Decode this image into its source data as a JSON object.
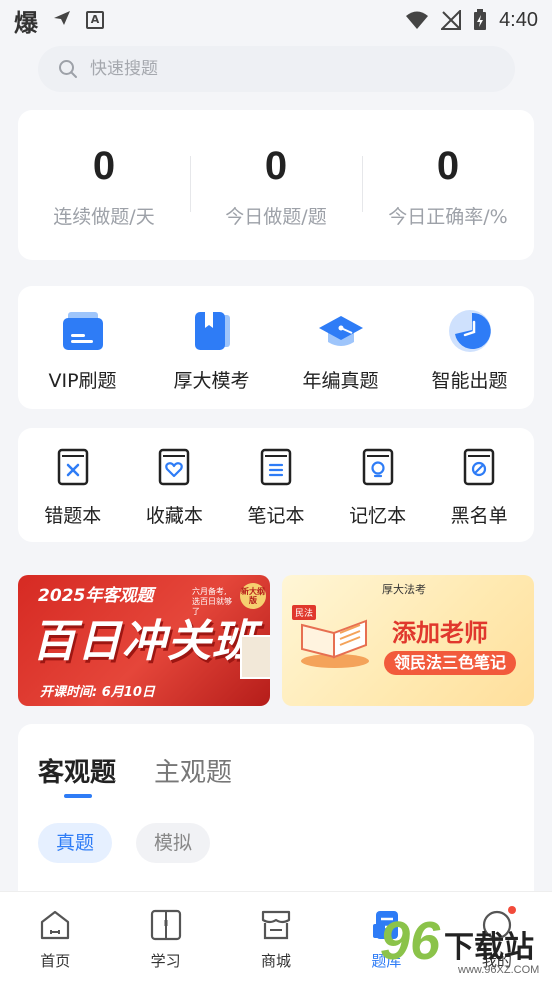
{
  "status_bar": {
    "app_char": "爆",
    "time": "4:40"
  },
  "search": {
    "placeholder": "快速搜题"
  },
  "stats": [
    {
      "value": "0",
      "label": "连续做题/天"
    },
    {
      "value": "0",
      "label": "今日做题/题"
    },
    {
      "value": "0",
      "label": "今日正确率/%"
    }
  ],
  "features": [
    {
      "label": "VIP刷题",
      "icon": "vip-card-icon"
    },
    {
      "label": "厚大模考",
      "icon": "bookmark-book-icon"
    },
    {
      "label": "年编真题",
      "icon": "graduation-cap-icon"
    },
    {
      "label": "智能出题",
      "icon": "pie-chart-icon"
    }
  ],
  "tools": [
    {
      "label": "错题本",
      "icon": "wrong-book-icon"
    },
    {
      "label": "收藏本",
      "icon": "heart-book-icon"
    },
    {
      "label": "笔记本",
      "icon": "note-book-icon"
    },
    {
      "label": "记忆本",
      "icon": "bulb-book-icon"
    },
    {
      "label": "黑名单",
      "icon": "block-book-icon"
    }
  ],
  "banners": {
    "left": {
      "year": "2025年客观题",
      "title": "百日冲关班",
      "date": "开课时间: 6月10日",
      "tag": "六月备考, 选百日就够了",
      "stamp": "新大纲版"
    },
    "right": {
      "brand": "厚大法考",
      "badge": "民法",
      "title": "添加老师",
      "subtitle": "领民法三色笔记"
    }
  },
  "question_tabs": [
    {
      "label": "客观题",
      "active": true
    },
    {
      "label": "主观题",
      "active": false
    }
  ],
  "question_filters": [
    {
      "label": "真题",
      "active": true
    },
    {
      "label": "模拟",
      "active": false
    }
  ],
  "bottom_nav": [
    {
      "label": "首页",
      "icon": "home-icon"
    },
    {
      "label": "学习",
      "icon": "book-icon"
    },
    {
      "label": "商城",
      "icon": "shop-icon"
    },
    {
      "label": "题库",
      "icon": "question-bank-icon"
    },
    {
      "label": "我的",
      "icon": "profile-icon"
    }
  ],
  "watermark": {
    "number": "96",
    "text": "下载站",
    "url": "www.96XZ.COM"
  },
  "colors": {
    "accent": "#2e7cf6",
    "background": "#f4f5f8",
    "banner_red": "#d62a23"
  }
}
